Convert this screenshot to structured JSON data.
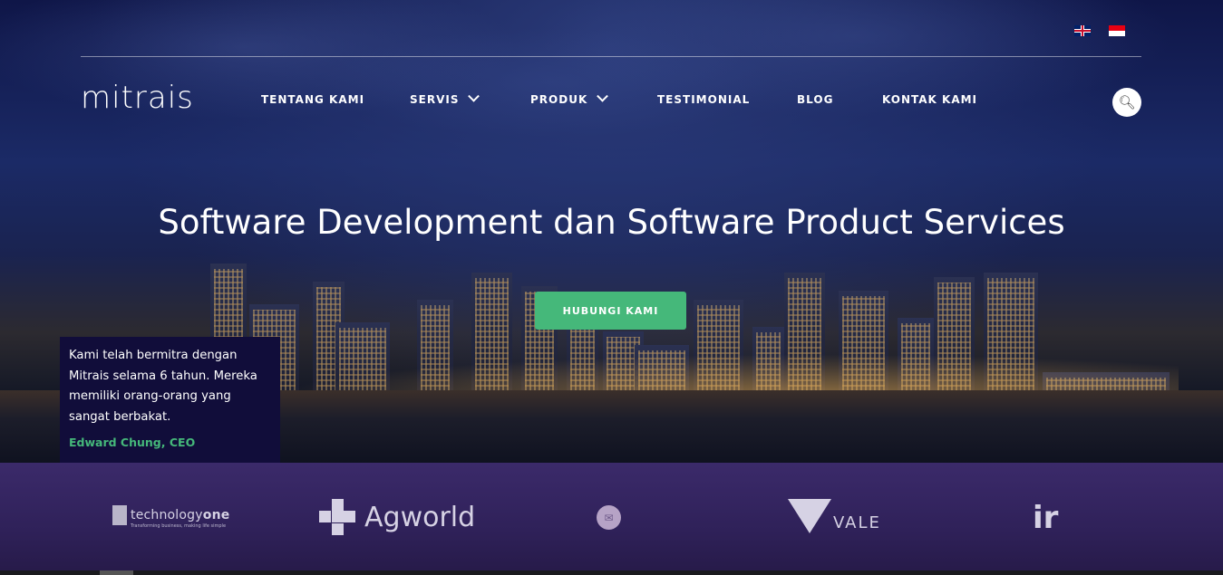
{
  "header": {
    "languages": [
      {
        "code": "en",
        "icon": "uk-flag-icon"
      },
      {
        "code": "id",
        "icon": "indonesia-flag-icon"
      }
    ],
    "logo_text": "mitrais",
    "nav": [
      {
        "label": "TENTANG KAMI",
        "has_dropdown": false
      },
      {
        "label": "SERVIS",
        "has_dropdown": true
      },
      {
        "label": "PRODUK",
        "has_dropdown": true
      },
      {
        "label": "TESTIMONIAL",
        "has_dropdown": false
      },
      {
        "label": "BLOG",
        "has_dropdown": false
      },
      {
        "label": "KONTAK KAMI",
        "has_dropdown": false
      }
    ],
    "search_icon": "search-icon"
  },
  "hero": {
    "title": "Software Development dan Software Product Services",
    "cta_label": "HUBUNGI KAMI",
    "cta_color": "#45b87a"
  },
  "testimonial": {
    "quote": "Kami telah bermitra dengan Mitrais selama 6 tahun. Mereka memiliki orang-orang yang sangat berbakat.",
    "author": "Edward Chung, CEO",
    "bg_color": "#110d3a",
    "author_color": "#45b87a"
  },
  "clients": {
    "logos": [
      {
        "name": "technologyone",
        "text_main": "technology",
        "text_bold": "one",
        "tagline": "Transforming business, making life simple"
      },
      {
        "name": "agworld",
        "text": "Agworld"
      },
      {
        "name": "circle-logo",
        "text": "✉"
      },
      {
        "name": "vale",
        "text": "VALE"
      },
      {
        "name": "ir",
        "text": "ir"
      }
    ],
    "bg_color": "#2f2159"
  }
}
